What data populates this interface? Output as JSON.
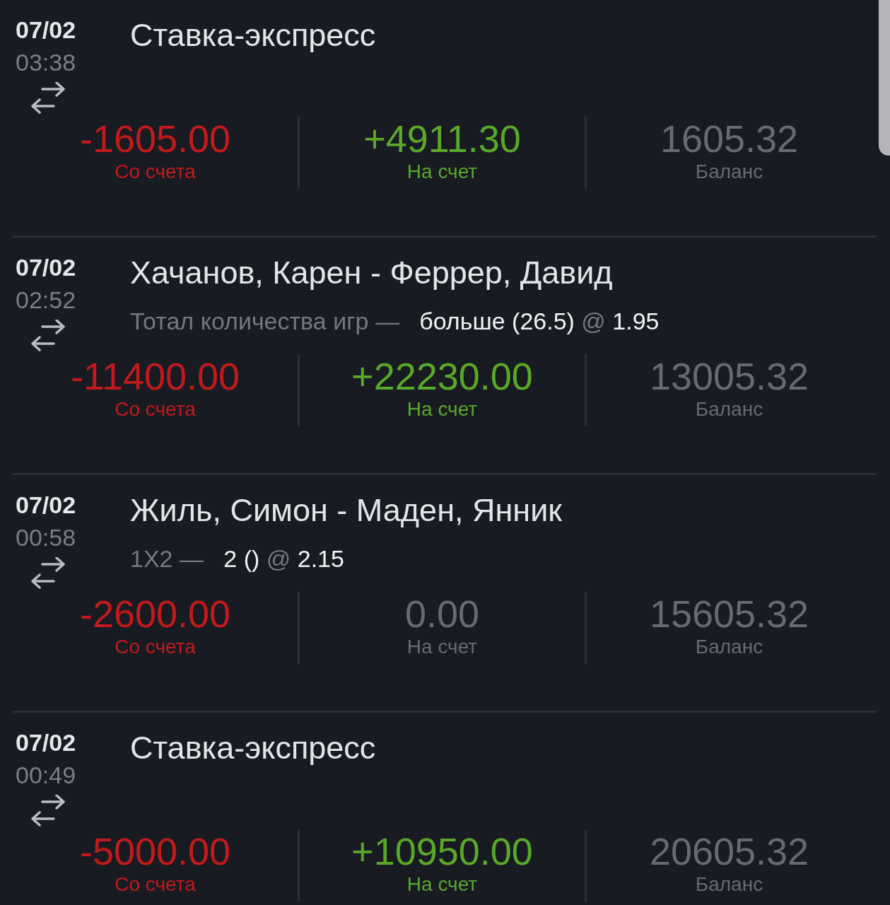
{
  "transactions": [
    {
      "date": "07/02",
      "time": "03:38",
      "title": "Ставка-экспресс",
      "amounts": [
        {
          "kind": "debit",
          "value": "-1605.00",
          "label": "Со счета"
        },
        {
          "kind": "credit",
          "value": "+4911.30",
          "label": "На счет"
        },
        {
          "kind": "balance",
          "value": "1605.32",
          "label": "Баланс"
        }
      ]
    },
    {
      "date": "07/02",
      "time": "02:52",
      "title": "Хачанов, Карен - Феррер, Давид",
      "bet": {
        "market": "Тотал количества игр",
        "separator": "—",
        "selection": "больше (26.5)",
        "at": "@",
        "odds": "1.95"
      },
      "amounts": [
        {
          "kind": "debit",
          "value": "-11400.00",
          "label": "Со счета"
        },
        {
          "kind": "credit",
          "value": "+22230.00",
          "label": "На счет"
        },
        {
          "kind": "balance",
          "value": "13005.32",
          "label": "Баланс"
        }
      ]
    },
    {
      "date": "07/02",
      "time": "00:58",
      "title": "Жиль, Симон - Маден, Янник",
      "bet": {
        "market": "1X2",
        "separator": "—",
        "selection": "2 ()",
        "at": "@",
        "odds": "2.15"
      },
      "amounts": [
        {
          "kind": "debit",
          "value": "-2600.00",
          "label": "Со счета"
        },
        {
          "kind": "zero",
          "value": "0.00",
          "label": "На счет"
        },
        {
          "kind": "balance",
          "value": "15605.32",
          "label": "Баланс"
        }
      ]
    },
    {
      "date": "07/02",
      "time": "00:49",
      "title": "Ставка-экспресс",
      "amounts": [
        {
          "kind": "debit",
          "value": "-5000.00",
          "label": "Со счета"
        },
        {
          "kind": "credit",
          "value": "+10950.00",
          "label": "На счет"
        },
        {
          "kind": "balance",
          "value": "20605.32",
          "label": "Баланс"
        }
      ]
    }
  ]
}
